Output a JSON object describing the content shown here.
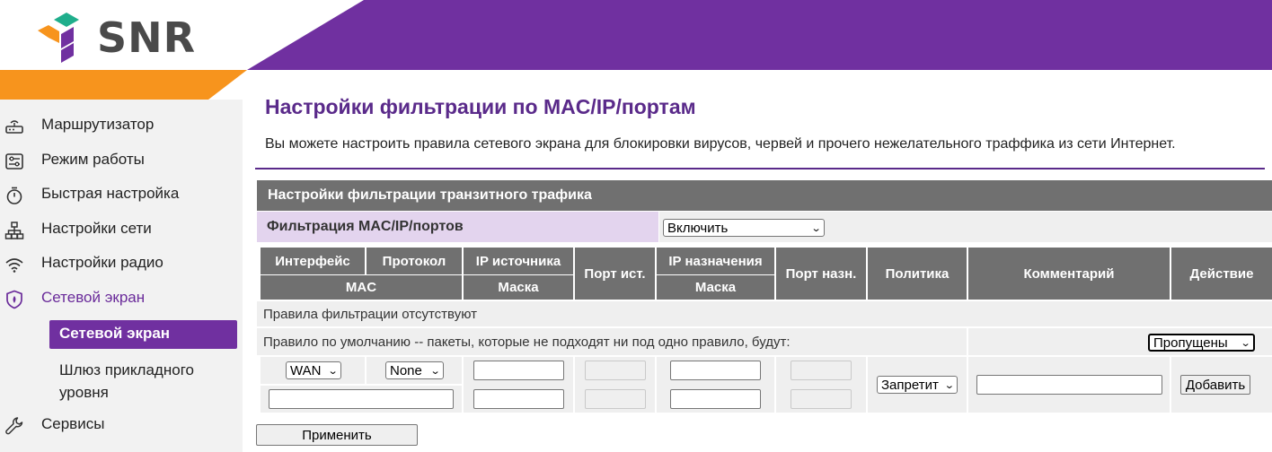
{
  "brand": {
    "logo_text": "SNR",
    "colors": {
      "purple": "#7030a0",
      "orange": "#f7941d",
      "teal": "#1fae8c",
      "header_gray": "#707070",
      "label_lavender": "#e3d4ee"
    }
  },
  "sidebar": {
    "items": [
      {
        "label": "Маршрутизатор",
        "icon": "router-icon"
      },
      {
        "label": "Режим работы",
        "icon": "mode-icon"
      },
      {
        "label": "Быстрая настройка",
        "icon": "stopwatch-icon"
      },
      {
        "label": "Настройки сети",
        "icon": "network-icon"
      },
      {
        "label": "Настройки радио",
        "icon": "wifi-icon"
      },
      {
        "label": "Сетевой экран",
        "icon": "shield-icon",
        "active": true
      },
      {
        "label": "Сервисы",
        "icon": "wrench-icon"
      }
    ],
    "subitems": [
      {
        "label": "Сетевой экран",
        "active": true
      },
      {
        "label": "Шлюз прикладного уровня"
      }
    ]
  },
  "page": {
    "title": "Настройки фильтрации по MAC/IP/портам",
    "description": "Вы можете настроить правила сетевого экрана для блокировки вирусов, червей и прочего нежелательного траффика из сети Интернет."
  },
  "panel": {
    "title": "Настройки фильтрации транзитного трафика",
    "filter_label": "Фильтрация MAC/IP/портов",
    "filter_value": "Включить"
  },
  "table": {
    "headers": {
      "interface": "Интерфейс",
      "protocol": "Протокол",
      "src_ip": "IP источника",
      "src_port": "Порт ист.",
      "dst_ip": "IP назначения",
      "dst_port": "Порт назн.",
      "policy": "Политика",
      "comment": "Комментарий",
      "action": "Действие",
      "mac": "MAC",
      "src_mask": "Маска",
      "dst_mask": "Маска"
    },
    "empty_text": "Правила фильтрации отсутствуют",
    "default_rule_text": "Правило по умолчанию -- пакеты, которые не подходят ни под одно правило, будут:",
    "default_rule_value": "Пропущены",
    "form": {
      "interface": "WAN",
      "protocol": "None",
      "policy": "Запретит",
      "add_button": "Добавить"
    }
  },
  "apply_button": "Применить"
}
